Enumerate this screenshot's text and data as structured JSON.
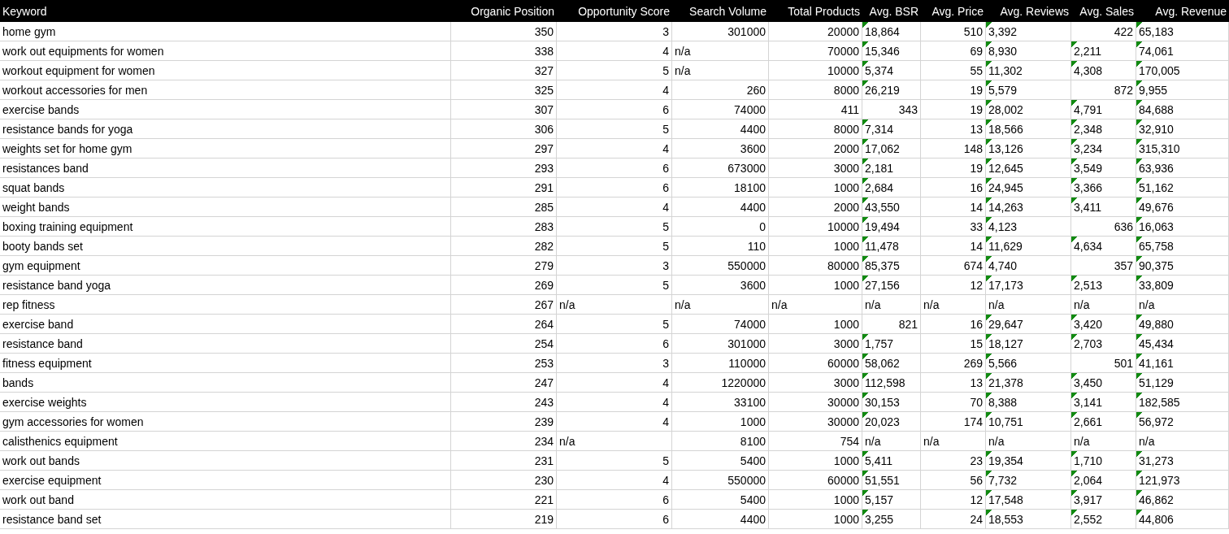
{
  "table": {
    "columns": [
      "Keyword",
      "Organic Position",
      "Opportunity Score",
      "Search Volume",
      "Total Products",
      "Avg. BSR",
      "Avg. Price",
      "Avg. Reviews",
      "Avg. Sales",
      "Avg. Revenue"
    ],
    "rows": [
      {
        "cells": [
          {
            "text": "home gym",
            "kind": "text"
          },
          {
            "text": "350",
            "kind": "number"
          },
          {
            "text": "3",
            "kind": "number"
          },
          {
            "text": "301000",
            "kind": "number"
          },
          {
            "text": "20000",
            "kind": "number"
          },
          {
            "text": "18,864",
            "kind": "flagged"
          },
          {
            "text": "510",
            "kind": "number"
          },
          {
            "text": "3,392",
            "kind": "flagged"
          },
          {
            "text": "422",
            "kind": "number"
          },
          {
            "text": "65,183",
            "kind": "flagged"
          }
        ]
      },
      {
        "cells": [
          {
            "text": "work out equipments for women",
            "kind": "text"
          },
          {
            "text": "338",
            "kind": "number"
          },
          {
            "text": "4",
            "kind": "number"
          },
          {
            "text": "n/a",
            "kind": "text"
          },
          {
            "text": "70000",
            "kind": "number"
          },
          {
            "text": "15,346",
            "kind": "flagged"
          },
          {
            "text": "69",
            "kind": "number"
          },
          {
            "text": "8,930",
            "kind": "flagged"
          },
          {
            "text": "2,211",
            "kind": "flagged"
          },
          {
            "text": "74,061",
            "kind": "flagged"
          }
        ]
      },
      {
        "cells": [
          {
            "text": "workout equipment for women",
            "kind": "text"
          },
          {
            "text": "327",
            "kind": "number"
          },
          {
            "text": "5",
            "kind": "number"
          },
          {
            "text": "n/a",
            "kind": "text"
          },
          {
            "text": "10000",
            "kind": "number"
          },
          {
            "text": "5,374",
            "kind": "flagged"
          },
          {
            "text": "55",
            "kind": "number"
          },
          {
            "text": "11,302",
            "kind": "flagged"
          },
          {
            "text": "4,308",
            "kind": "flagged"
          },
          {
            "text": "170,005",
            "kind": "flagged"
          }
        ]
      },
      {
        "cells": [
          {
            "text": "workout accessories for men",
            "kind": "text"
          },
          {
            "text": "325",
            "kind": "number"
          },
          {
            "text": "4",
            "kind": "number"
          },
          {
            "text": "260",
            "kind": "number"
          },
          {
            "text": "8000",
            "kind": "number"
          },
          {
            "text": "26,219",
            "kind": "flagged"
          },
          {
            "text": "19",
            "kind": "number"
          },
          {
            "text": "5,579",
            "kind": "flagged"
          },
          {
            "text": "872",
            "kind": "number"
          },
          {
            "text": "9,955",
            "kind": "flagged"
          }
        ]
      },
      {
        "cells": [
          {
            "text": "exercise bands",
            "kind": "text"
          },
          {
            "text": "307",
            "kind": "number"
          },
          {
            "text": "6",
            "kind": "number"
          },
          {
            "text": "74000",
            "kind": "number"
          },
          {
            "text": "411",
            "kind": "number"
          },
          {
            "text": "343",
            "kind": "number"
          },
          {
            "text": "19",
            "kind": "number"
          },
          {
            "text": "28,002",
            "kind": "flagged"
          },
          {
            "text": "4,791",
            "kind": "flagged"
          },
          {
            "text": "84,688",
            "kind": "flagged"
          }
        ]
      },
      {
        "cells": [
          {
            "text": "resistance bands for yoga",
            "kind": "text"
          },
          {
            "text": "306",
            "kind": "number"
          },
          {
            "text": "5",
            "kind": "number"
          },
          {
            "text": "4400",
            "kind": "number"
          },
          {
            "text": "8000",
            "kind": "number"
          },
          {
            "text": "7,314",
            "kind": "flagged"
          },
          {
            "text": "13",
            "kind": "number"
          },
          {
            "text": "18,566",
            "kind": "flagged"
          },
          {
            "text": "2,348",
            "kind": "flagged"
          },
          {
            "text": "32,910",
            "kind": "flagged"
          }
        ]
      },
      {
        "cells": [
          {
            "text": "weights set for home gym",
            "kind": "text"
          },
          {
            "text": "297",
            "kind": "number"
          },
          {
            "text": "4",
            "kind": "number"
          },
          {
            "text": "3600",
            "kind": "number"
          },
          {
            "text": "2000",
            "kind": "number"
          },
          {
            "text": "17,062",
            "kind": "flagged"
          },
          {
            "text": "148",
            "kind": "number"
          },
          {
            "text": "13,126",
            "kind": "flagged"
          },
          {
            "text": "3,234",
            "kind": "flagged"
          },
          {
            "text": "315,310",
            "kind": "flagged"
          }
        ]
      },
      {
        "cells": [
          {
            "text": "resistances band",
            "kind": "text"
          },
          {
            "text": "293",
            "kind": "number"
          },
          {
            "text": "6",
            "kind": "number"
          },
          {
            "text": "673000",
            "kind": "number"
          },
          {
            "text": "3000",
            "kind": "number"
          },
          {
            "text": "2,181",
            "kind": "flagged"
          },
          {
            "text": "19",
            "kind": "number"
          },
          {
            "text": "12,645",
            "kind": "flagged"
          },
          {
            "text": "3,549",
            "kind": "flagged"
          },
          {
            "text": "63,936",
            "kind": "flagged"
          }
        ]
      },
      {
        "cells": [
          {
            "text": "squat bands",
            "kind": "text"
          },
          {
            "text": "291",
            "kind": "number"
          },
          {
            "text": "6",
            "kind": "number"
          },
          {
            "text": "18100",
            "kind": "number"
          },
          {
            "text": "1000",
            "kind": "number"
          },
          {
            "text": "2,684",
            "kind": "flagged"
          },
          {
            "text": "16",
            "kind": "number"
          },
          {
            "text": "24,945",
            "kind": "flagged"
          },
          {
            "text": "3,366",
            "kind": "flagged"
          },
          {
            "text": "51,162",
            "kind": "flagged"
          }
        ]
      },
      {
        "cells": [
          {
            "text": "weight bands",
            "kind": "text"
          },
          {
            "text": "285",
            "kind": "number"
          },
          {
            "text": "4",
            "kind": "number"
          },
          {
            "text": "4400",
            "kind": "number"
          },
          {
            "text": "2000",
            "kind": "number"
          },
          {
            "text": "43,550",
            "kind": "flagged"
          },
          {
            "text": "14",
            "kind": "number"
          },
          {
            "text": "14,263",
            "kind": "flagged"
          },
          {
            "text": "3,411",
            "kind": "flagged"
          },
          {
            "text": "49,676",
            "kind": "flagged"
          }
        ]
      },
      {
        "cells": [
          {
            "text": "boxing training equipment",
            "kind": "text"
          },
          {
            "text": "283",
            "kind": "number"
          },
          {
            "text": "5",
            "kind": "number"
          },
          {
            "text": "0",
            "kind": "number"
          },
          {
            "text": "10000",
            "kind": "number"
          },
          {
            "text": "19,494",
            "kind": "flagged"
          },
          {
            "text": "33",
            "kind": "number"
          },
          {
            "text": "4,123",
            "kind": "flagged"
          },
          {
            "text": "636",
            "kind": "number"
          },
          {
            "text": "16,063",
            "kind": "flagged"
          }
        ]
      },
      {
        "cells": [
          {
            "text": "booty bands set",
            "kind": "text"
          },
          {
            "text": "282",
            "kind": "number"
          },
          {
            "text": "5",
            "kind": "number"
          },
          {
            "text": "110",
            "kind": "number"
          },
          {
            "text": "1000",
            "kind": "number"
          },
          {
            "text": "11,478",
            "kind": "flagged"
          },
          {
            "text": "14",
            "kind": "number"
          },
          {
            "text": "11,629",
            "kind": "flagged"
          },
          {
            "text": "4,634",
            "kind": "flagged"
          },
          {
            "text": "65,758",
            "kind": "flagged"
          }
        ]
      },
      {
        "cells": [
          {
            "text": "gym equipment",
            "kind": "text"
          },
          {
            "text": "279",
            "kind": "number"
          },
          {
            "text": "3",
            "kind": "number"
          },
          {
            "text": "550000",
            "kind": "number"
          },
          {
            "text": "80000",
            "kind": "number"
          },
          {
            "text": "85,375",
            "kind": "flagged"
          },
          {
            "text": "674",
            "kind": "number"
          },
          {
            "text": "4,740",
            "kind": "flagged"
          },
          {
            "text": "357",
            "kind": "number"
          },
          {
            "text": "90,375",
            "kind": "flagged"
          }
        ]
      },
      {
        "cells": [
          {
            "text": "resistance band yoga",
            "kind": "text"
          },
          {
            "text": "269",
            "kind": "number"
          },
          {
            "text": "5",
            "kind": "number"
          },
          {
            "text": "3600",
            "kind": "number"
          },
          {
            "text": "1000",
            "kind": "number"
          },
          {
            "text": "27,156",
            "kind": "flagged"
          },
          {
            "text": "12",
            "kind": "number"
          },
          {
            "text": "17,173",
            "kind": "flagged"
          },
          {
            "text": "2,513",
            "kind": "flagged"
          },
          {
            "text": "33,809",
            "kind": "flagged"
          }
        ]
      },
      {
        "cells": [
          {
            "text": "rep fitness",
            "kind": "text"
          },
          {
            "text": "267",
            "kind": "number"
          },
          {
            "text": "n/a",
            "kind": "text"
          },
          {
            "text": "n/a",
            "kind": "text"
          },
          {
            "text": "n/a",
            "kind": "text"
          },
          {
            "text": "n/a",
            "kind": "text"
          },
          {
            "text": "n/a",
            "kind": "text"
          },
          {
            "text": "n/a",
            "kind": "text"
          },
          {
            "text": "n/a",
            "kind": "text"
          },
          {
            "text": "n/a",
            "kind": "text"
          }
        ]
      },
      {
        "cells": [
          {
            "text": "exercise band",
            "kind": "text"
          },
          {
            "text": "264",
            "kind": "number"
          },
          {
            "text": "5",
            "kind": "number"
          },
          {
            "text": "74000",
            "kind": "number"
          },
          {
            "text": "1000",
            "kind": "number"
          },
          {
            "text": "821",
            "kind": "number"
          },
          {
            "text": "16",
            "kind": "number"
          },
          {
            "text": "29,647",
            "kind": "flagged"
          },
          {
            "text": "3,420",
            "kind": "flagged"
          },
          {
            "text": "49,880",
            "kind": "flagged"
          }
        ]
      },
      {
        "cells": [
          {
            "text": "resistance band",
            "kind": "text"
          },
          {
            "text": "254",
            "kind": "number"
          },
          {
            "text": "6",
            "kind": "number"
          },
          {
            "text": "301000",
            "kind": "number"
          },
          {
            "text": "3000",
            "kind": "number"
          },
          {
            "text": "1,757",
            "kind": "flagged"
          },
          {
            "text": "15",
            "kind": "number"
          },
          {
            "text": "18,127",
            "kind": "flagged"
          },
          {
            "text": "2,703",
            "kind": "flagged"
          },
          {
            "text": "45,434",
            "kind": "flagged"
          }
        ]
      },
      {
        "cells": [
          {
            "text": "fitness equipment",
            "kind": "text"
          },
          {
            "text": "253",
            "kind": "number"
          },
          {
            "text": "3",
            "kind": "number"
          },
          {
            "text": "110000",
            "kind": "number"
          },
          {
            "text": "60000",
            "kind": "number"
          },
          {
            "text": "58,062",
            "kind": "flagged"
          },
          {
            "text": "269",
            "kind": "number"
          },
          {
            "text": "5,566",
            "kind": "flagged"
          },
          {
            "text": "501",
            "kind": "number"
          },
          {
            "text": "41,161",
            "kind": "flagged"
          }
        ]
      },
      {
        "cells": [
          {
            "text": "bands",
            "kind": "text"
          },
          {
            "text": "247",
            "kind": "number"
          },
          {
            "text": "4",
            "kind": "number"
          },
          {
            "text": "1220000",
            "kind": "number"
          },
          {
            "text": "3000",
            "kind": "number"
          },
          {
            "text": "112,598",
            "kind": "flagged"
          },
          {
            "text": "13",
            "kind": "number"
          },
          {
            "text": "21,378",
            "kind": "flagged"
          },
          {
            "text": "3,450",
            "kind": "flagged"
          },
          {
            "text": "51,129",
            "kind": "flagged"
          }
        ]
      },
      {
        "cells": [
          {
            "text": "exercise weights",
            "kind": "text"
          },
          {
            "text": "243",
            "kind": "number"
          },
          {
            "text": "4",
            "kind": "number"
          },
          {
            "text": "33100",
            "kind": "number"
          },
          {
            "text": "30000",
            "kind": "number"
          },
          {
            "text": "30,153",
            "kind": "flagged"
          },
          {
            "text": "70",
            "kind": "number"
          },
          {
            "text": "8,388",
            "kind": "flagged"
          },
          {
            "text": "3,141",
            "kind": "flagged"
          },
          {
            "text": "182,585",
            "kind": "flagged"
          }
        ]
      },
      {
        "cells": [
          {
            "text": "gym accessories for women",
            "kind": "text"
          },
          {
            "text": "239",
            "kind": "number"
          },
          {
            "text": "4",
            "kind": "number"
          },
          {
            "text": "1000",
            "kind": "number"
          },
          {
            "text": "30000",
            "kind": "number"
          },
          {
            "text": "20,023",
            "kind": "flagged"
          },
          {
            "text": "174",
            "kind": "number"
          },
          {
            "text": "10,751",
            "kind": "flagged"
          },
          {
            "text": "2,661",
            "kind": "flagged"
          },
          {
            "text": "56,972",
            "kind": "flagged"
          }
        ]
      },
      {
        "cells": [
          {
            "text": "calisthenics equipment",
            "kind": "text"
          },
          {
            "text": "234",
            "kind": "number"
          },
          {
            "text": "n/a",
            "kind": "text"
          },
          {
            "text": "8100",
            "kind": "number"
          },
          {
            "text": "754",
            "kind": "number"
          },
          {
            "text": "n/a",
            "kind": "text"
          },
          {
            "text": "n/a",
            "kind": "text"
          },
          {
            "text": "n/a",
            "kind": "text"
          },
          {
            "text": "n/a",
            "kind": "text"
          },
          {
            "text": "n/a",
            "kind": "text"
          }
        ]
      },
      {
        "cells": [
          {
            "text": "work out bands",
            "kind": "text"
          },
          {
            "text": "231",
            "kind": "number"
          },
          {
            "text": "5",
            "kind": "number"
          },
          {
            "text": "5400",
            "kind": "number"
          },
          {
            "text": "1000",
            "kind": "number"
          },
          {
            "text": "5,411",
            "kind": "flagged"
          },
          {
            "text": "23",
            "kind": "number"
          },
          {
            "text": "19,354",
            "kind": "flagged"
          },
          {
            "text": "1,710",
            "kind": "flagged"
          },
          {
            "text": "31,273",
            "kind": "flagged"
          }
        ]
      },
      {
        "cells": [
          {
            "text": "exercise equipment",
            "kind": "text"
          },
          {
            "text": "230",
            "kind": "number"
          },
          {
            "text": "4",
            "kind": "number"
          },
          {
            "text": "550000",
            "kind": "number"
          },
          {
            "text": "60000",
            "kind": "number"
          },
          {
            "text": "51,551",
            "kind": "flagged"
          },
          {
            "text": "56",
            "kind": "number"
          },
          {
            "text": "7,732",
            "kind": "flagged"
          },
          {
            "text": "2,064",
            "kind": "flagged"
          },
          {
            "text": "121,973",
            "kind": "flagged"
          }
        ]
      },
      {
        "cells": [
          {
            "text": "work out band",
            "kind": "text"
          },
          {
            "text": "221",
            "kind": "number"
          },
          {
            "text": "6",
            "kind": "number"
          },
          {
            "text": "5400",
            "kind": "number"
          },
          {
            "text": "1000",
            "kind": "number"
          },
          {
            "text": "5,157",
            "kind": "flagged"
          },
          {
            "text": "12",
            "kind": "number"
          },
          {
            "text": "17,548",
            "kind": "flagged"
          },
          {
            "text": "3,917",
            "kind": "flagged"
          },
          {
            "text": "46,862",
            "kind": "flagged"
          }
        ]
      },
      {
        "cells": [
          {
            "text": "resistance band set",
            "kind": "text"
          },
          {
            "text": "219",
            "kind": "number"
          },
          {
            "text": "6",
            "kind": "number"
          },
          {
            "text": "4400",
            "kind": "number"
          },
          {
            "text": "1000",
            "kind": "number"
          },
          {
            "text": "3,255",
            "kind": "flagged"
          },
          {
            "text": "24",
            "kind": "number"
          },
          {
            "text": "18,553",
            "kind": "flagged"
          },
          {
            "text": "2,552",
            "kind": "flagged"
          },
          {
            "text": "44,806",
            "kind": "flagged"
          }
        ]
      }
    ]
  }
}
